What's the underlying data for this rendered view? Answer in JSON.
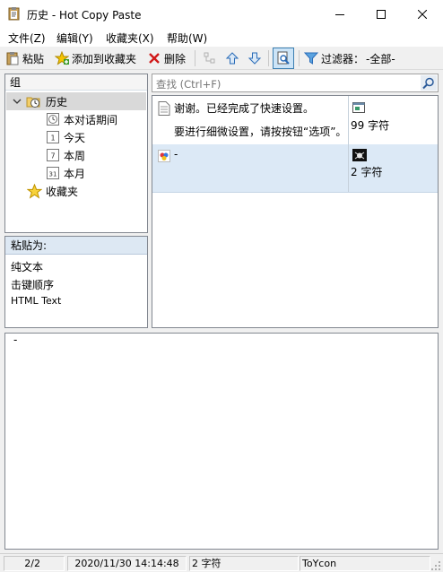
{
  "window": {
    "title": "历史 - Hot Copy Paste",
    "buttons": {
      "minimize": "—",
      "maximize": "☐",
      "close": "✕"
    }
  },
  "menu": [
    "文件(Z)",
    "编辑(Y)",
    "收藏夹(X)",
    "帮助(W)"
  ],
  "toolbar": {
    "paste": "粘贴",
    "add_favorite": "添加到收藏夹",
    "delete": "删除",
    "filter_label": "过滤器：",
    "filter_value": "-全部-"
  },
  "group": {
    "header": "组",
    "history": "历史",
    "children": [
      {
        "label": "本对话期间",
        "icon": "session-clock-icon",
        "badge": ""
      },
      {
        "label": "今天",
        "icon": "calendar-day-icon",
        "badge": "1"
      },
      {
        "label": "本周",
        "icon": "calendar-week-icon",
        "badge": "7"
      },
      {
        "label": "本月",
        "icon": "calendar-month-icon",
        "badge": "31"
      }
    ],
    "favorites": "收藏夹"
  },
  "paste_as": {
    "header": "粘贴为:",
    "items": [
      "纯文本",
      "击键顺序",
      "HTML Text"
    ]
  },
  "search": {
    "placeholder": "查找 (Ctrl+F)"
  },
  "clips": [
    {
      "line1": "谢谢。已经完成了快速设置。",
      "line2": "要进行细微设置，请按按钮“选项”。",
      "size": "99 字符",
      "icon": "text-document-icon",
      "source_icon": "app-window-icon"
    },
    {
      "line1": "-",
      "line2": "",
      "size": "2 字符",
      "icon": "color-picker-icon",
      "source_icon": "bug-icon"
    }
  ],
  "preview_text": "-",
  "status": {
    "count": "2/2",
    "datetime": "2020/11/30 14:14:48",
    "chars": "2 字符",
    "app": "ToYcon"
  }
}
